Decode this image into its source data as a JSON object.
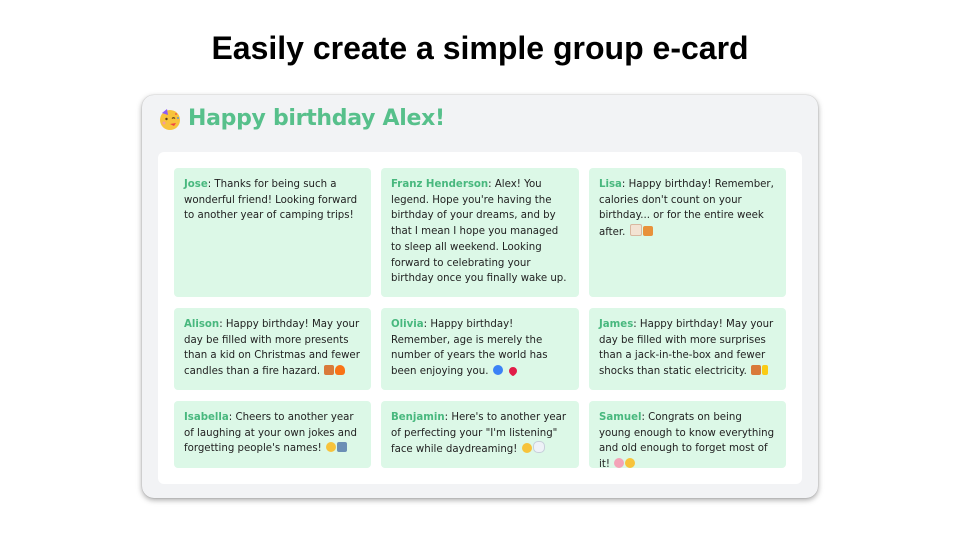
{
  "slide": {
    "title": "Easily create a simple group e-card"
  },
  "card": {
    "heading": "Happy birthday Alex!",
    "heading_icon": "party-face-icon",
    "accent_color": "#57c08b",
    "message_bg": "#dcf8e7",
    "messages": [
      {
        "author": "Jose",
        "text": ": Thanks for being such a wonderful friend! Looking forward to another year of camping trips!",
        "emoji": []
      },
      {
        "author": "Franz Henderson",
        "text": ": Alex! You legend. Hope you're having the birthday of your dreams, and by that I mean I hope you managed to sleep all weekend. Looking forward to celebrating your birthday once you finally wake up.",
        "emoji": []
      },
      {
        "author": "Lisa",
        "text": ": Happy birthday! Remember, calories don't count on your birthday... or for the entire week after. ",
        "emoji": [
          "cake-icon",
          "pizza-icon"
        ]
      },
      {
        "author": "Alison",
        "text": ": Happy birthday! May your day be filled with more presents than a kid on Christmas and fewer candles than a fire hazard. ",
        "emoji": [
          "gift-icon",
          "fire-icon"
        ]
      },
      {
        "author": "Olivia",
        "text": ": Happy birthday! Remember, age is merely the number of years the world has been enjoying you. ",
        "emoji": [
          "globe-icon",
          "heart-icon"
        ]
      },
      {
        "author": "James",
        "text": ": Happy birthday! May your day be filled with more surprises than a jack-in-the-box and fewer shocks than static electricity. ",
        "emoji": [
          "gift-icon",
          "lightning-icon"
        ]
      },
      {
        "author": "Isabella",
        "text": ": Cheers to another year of laughing at your own jokes and forgetting people's names! ",
        "emoji": [
          "laughing-face-icon",
          "people-icon"
        ]
      },
      {
        "author": "Benjamin",
        "text": ": Here's to another year of perfecting your \"I'm listening\" face while daydreaming! ",
        "emoji": [
          "smirk-face-icon",
          "thought-cloud-icon"
        ]
      },
      {
        "author": "Samuel",
        "text": ": Congrats on being young enough to know everything and old enough to forget most of it! ",
        "emoji": [
          "brain-icon",
          "thinking-face-icon"
        ]
      }
    ]
  }
}
